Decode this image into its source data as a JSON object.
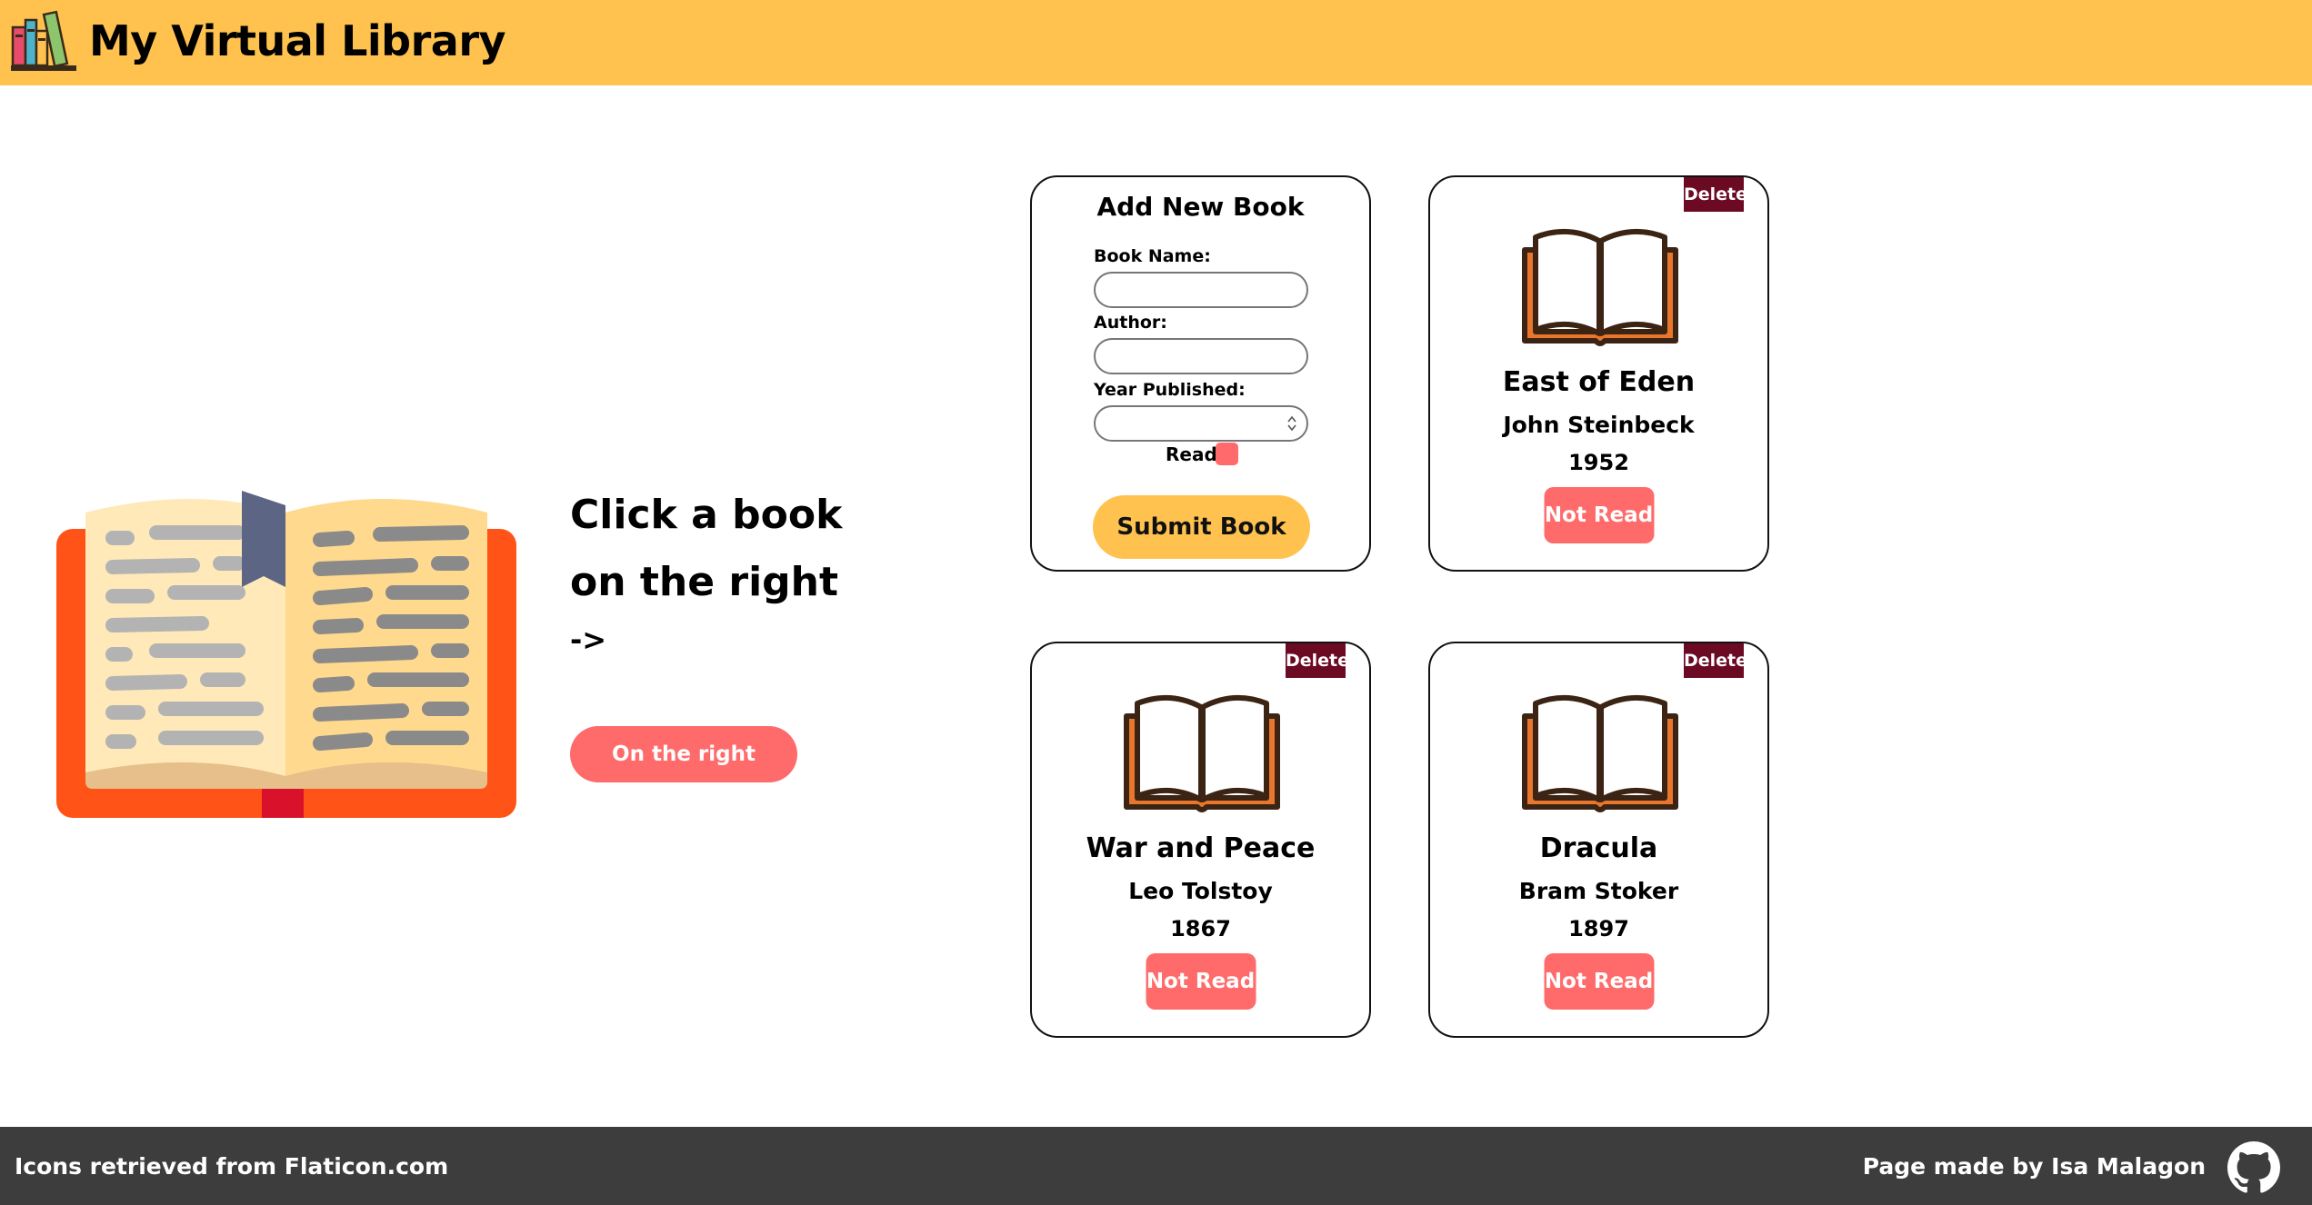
{
  "header": {
    "title": "My Virtual Library",
    "logo_icon": "bookshelf-icon",
    "background": "#ffc24f"
  },
  "hero": {
    "heading_line1": "Click a book",
    "heading_line2": "on the right",
    "arrow": "->",
    "button_label": "On the right",
    "illustration_icon": "open-book-illustration"
  },
  "form": {
    "title": "Add New Book",
    "book_name_label": "Book Name:",
    "book_name_value": "",
    "author_label": "Author:",
    "author_value": "",
    "year_label": "Year Published:",
    "year_value": "",
    "read_label": "Read",
    "read_checked": false,
    "submit_label": "Submit Book"
  },
  "books": [
    {
      "title": "East of Eden",
      "author": "John Steinbeck",
      "year": "1952",
      "status": "Not Read",
      "delete_label": "Delete",
      "icon": "book-icon"
    },
    {
      "title": "War and Peace",
      "author": "Leo Tolstoy",
      "year": "1867",
      "status": "Not Read",
      "delete_label": "Delete",
      "icon": "book-icon"
    },
    {
      "title": "Dracula",
      "author": "Bram Stoker",
      "year": "1897",
      "status": "Not Read",
      "delete_label": "Delete",
      "icon": "book-icon"
    }
  ],
  "footer": {
    "left_text": "Icons retrieved from Flaticon.com",
    "right_text": "Page made by Isa Malagon",
    "github_icon": "github-icon"
  },
  "colors": {
    "accent_yellow": "#ffc24f",
    "accent_red": "#ff6b6b",
    "delete_maroon": "#6b0a22",
    "footer_bg": "#3d3d3d"
  }
}
